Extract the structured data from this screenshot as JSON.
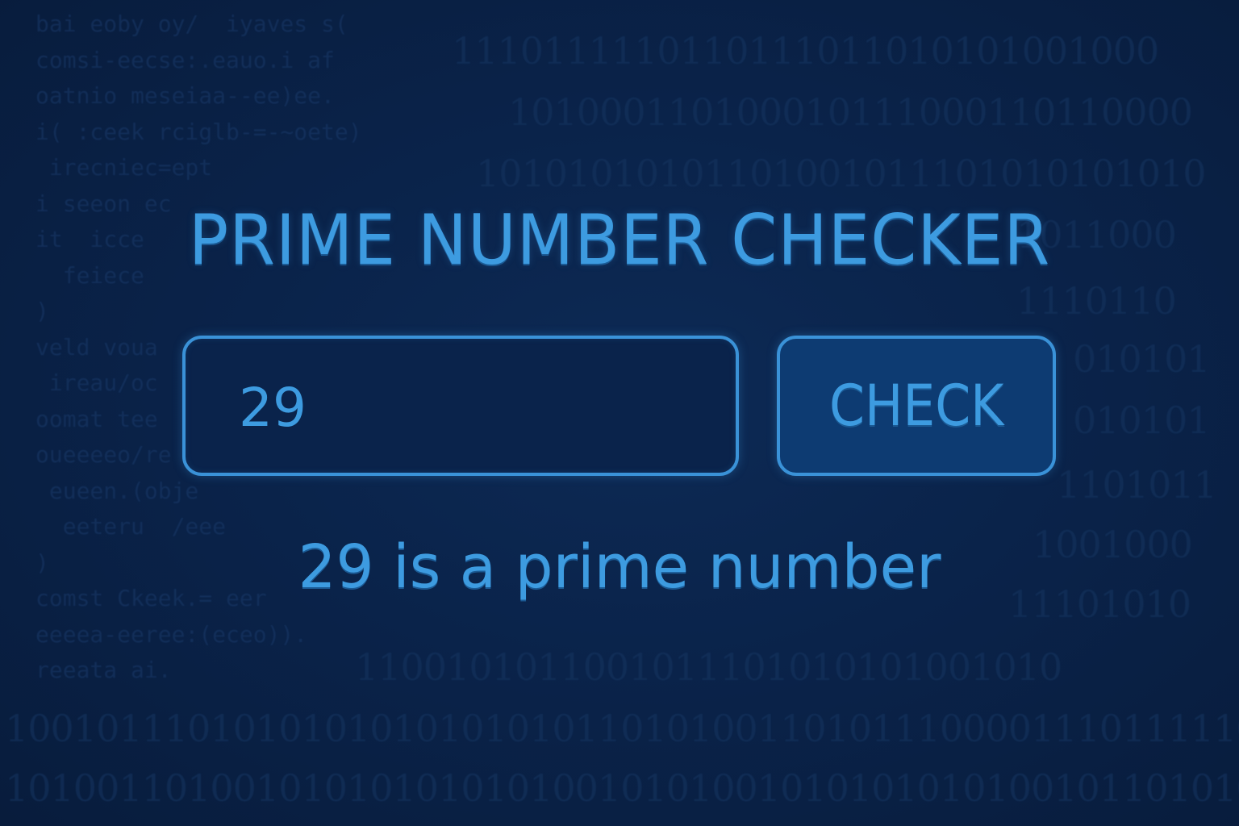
{
  "app": {
    "title": "PRIME NUMBER CHECKER"
  },
  "input": {
    "value": "29"
  },
  "button": {
    "label": "CHECK"
  },
  "result": {
    "text": "29 is a prime number"
  },
  "colors": {
    "background": "#0a2146",
    "accent": "#3d9be0",
    "button_fill": "#0d3b72"
  }
}
